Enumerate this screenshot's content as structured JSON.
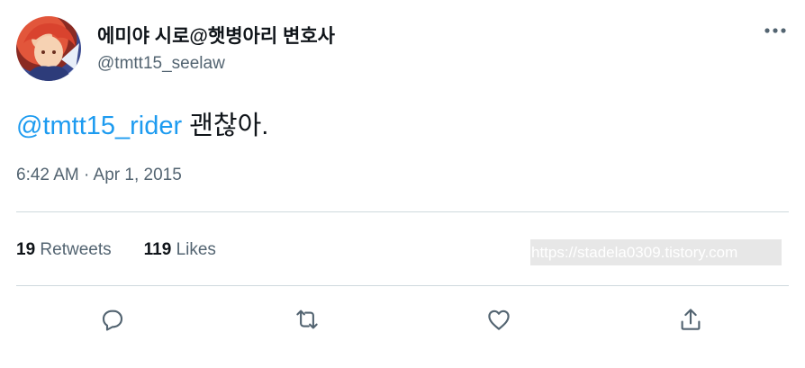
{
  "author": {
    "display_name": "에미야 시로@햇병아리 변호사",
    "handle": "@tmtt15_seelaw",
    "avatar_icon": "profile-avatar"
  },
  "tweet": {
    "mention": "@tmtt15_rider",
    "text": " 괜찮아.",
    "timestamp": "6:42 AM · Apr 1, 2015"
  },
  "stats": {
    "retweets_count": "19",
    "retweets_label": "Retweets",
    "likes_count": "119",
    "likes_label": "Likes"
  },
  "watermark": "https://stadela0309.tistory.com",
  "actions": [
    {
      "icon": "reply-icon"
    },
    {
      "icon": "retweet-icon"
    },
    {
      "icon": "like-icon"
    },
    {
      "icon": "share-icon"
    }
  ],
  "colors": {
    "text_primary": "#0f1419",
    "text_secondary": "#536471",
    "accent": "#1d9bf0",
    "divider": "#cfd9de"
  }
}
